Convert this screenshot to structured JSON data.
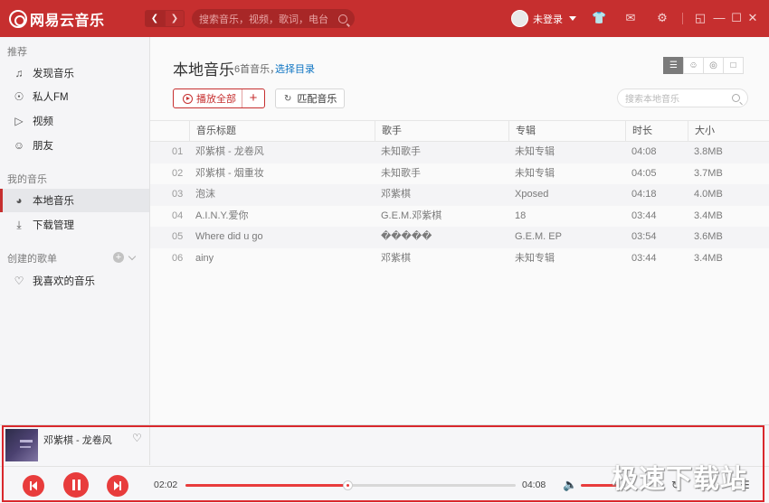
{
  "app": {
    "logo_text": "网易云音乐",
    "search_placeholder": "搜索音乐，视频，歌词，电台",
    "user_label": "未登录"
  },
  "sidebar": {
    "section_recommend": "推荐",
    "recommend_items": [
      {
        "label": "发现音乐",
        "icon": "music-note-icon"
      },
      {
        "label": "私人FM",
        "icon": "radio-icon"
      },
      {
        "label": "视频",
        "icon": "video-icon"
      },
      {
        "label": "朋友",
        "icon": "friends-icon"
      }
    ],
    "section_my_music": "我的音乐",
    "my_music_items": [
      {
        "label": "本地音乐",
        "icon": "local-music-icon",
        "active": true
      },
      {
        "label": "下载管理",
        "icon": "download-icon"
      }
    ],
    "section_playlists": "创建的歌单",
    "playlist_items": [
      {
        "label": "我喜欢的音乐",
        "icon": "heart-icon"
      }
    ]
  },
  "main": {
    "title": "本地音乐",
    "count_label": "6首音乐，",
    "select_dir_label": "选择目录",
    "play_all_label": "播放全部",
    "add_label": "+",
    "match_label": "匹配音乐",
    "search_placeholder": "搜索本地音乐",
    "columns": [
      "音乐标题",
      "歌手",
      "专辑",
      "时长",
      "大小"
    ],
    "rows": [
      {
        "index": "01",
        "title": "邓紫棋 - 龙卷风",
        "artist": "未知歌手",
        "album": "未知专辑",
        "duration": "04:08",
        "size": "3.8MB"
      },
      {
        "index": "02",
        "title": "邓紫棋 - 烟重妆",
        "artist": "未知歌手",
        "album": "未知专辑",
        "duration": "04:05",
        "size": "3.7MB"
      },
      {
        "index": "03",
        "title": "泡沫",
        "artist": "邓紫棋",
        "album": "Xposed",
        "duration": "04:18",
        "size": "4.0MB"
      },
      {
        "index": "04",
        "title": "A.I.N.Y.爱你",
        "artist": "G.E.M.邓紫棋",
        "album": "18",
        "duration": "03:44",
        "size": "3.4MB"
      },
      {
        "index": "05",
        "title": "Where did u go",
        "artist": "�����",
        "album": "G.E.M. EP",
        "duration": "03:54",
        "size": "3.6MB"
      },
      {
        "index": "06",
        "title": "ainy",
        "artist": "邓紫棋",
        "album": "未知专辑",
        "duration": "03:44",
        "size": "3.4MB"
      }
    ]
  },
  "player": {
    "now_playing": "邓紫棋 - 龙卷风",
    "current_time": "02:02",
    "total_time": "04:08",
    "progress_fraction": 0.49,
    "watermark": "极速下载站"
  },
  "colors": {
    "brand_red": "#c62f2f",
    "accent_red": "#e83c3c",
    "link_blue": "#0c73c2"
  }
}
